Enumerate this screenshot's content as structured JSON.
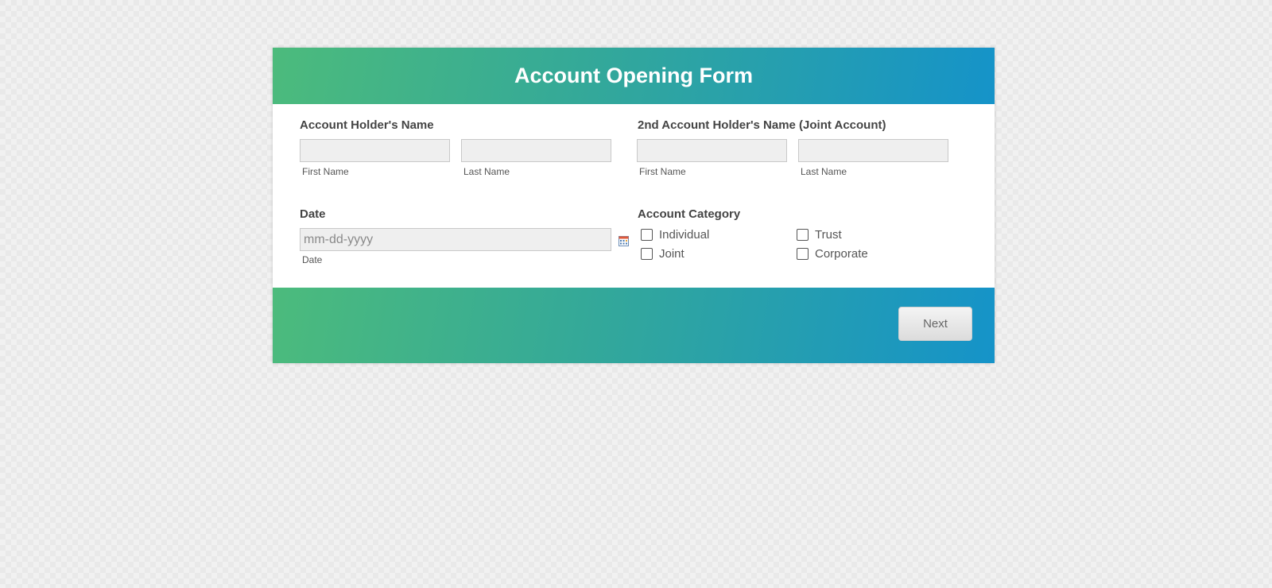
{
  "form": {
    "title": "Account Opening Form"
  },
  "holder": {
    "label": "Account Holder's Name",
    "first_name_value": "",
    "first_name_sub": "First Name",
    "last_name_value": "",
    "last_name_sub": "Last Name"
  },
  "joint_holder": {
    "label": "2nd Account Holder's Name (Joint Account)",
    "first_name_value": "",
    "first_name_sub": "First Name",
    "last_name_value": "",
    "last_name_sub": "Last Name"
  },
  "date": {
    "label": "Date",
    "placeholder": "mm-dd-yyyy",
    "value": "",
    "sub": "Date",
    "picker_icon": "calendar-icon"
  },
  "category": {
    "label": "Account Category",
    "options": [
      {
        "label": "Individual",
        "checked": false
      },
      {
        "label": "Trust",
        "checked": false
      },
      {
        "label": "Joint",
        "checked": false
      },
      {
        "label": "Corporate",
        "checked": false
      }
    ]
  },
  "footer": {
    "next_label": "Next"
  },
  "colors": {
    "gradient_start": "#4cbb7c",
    "gradient_end": "#1593c9",
    "input_bg": "#efefef",
    "label_text": "#444444"
  }
}
